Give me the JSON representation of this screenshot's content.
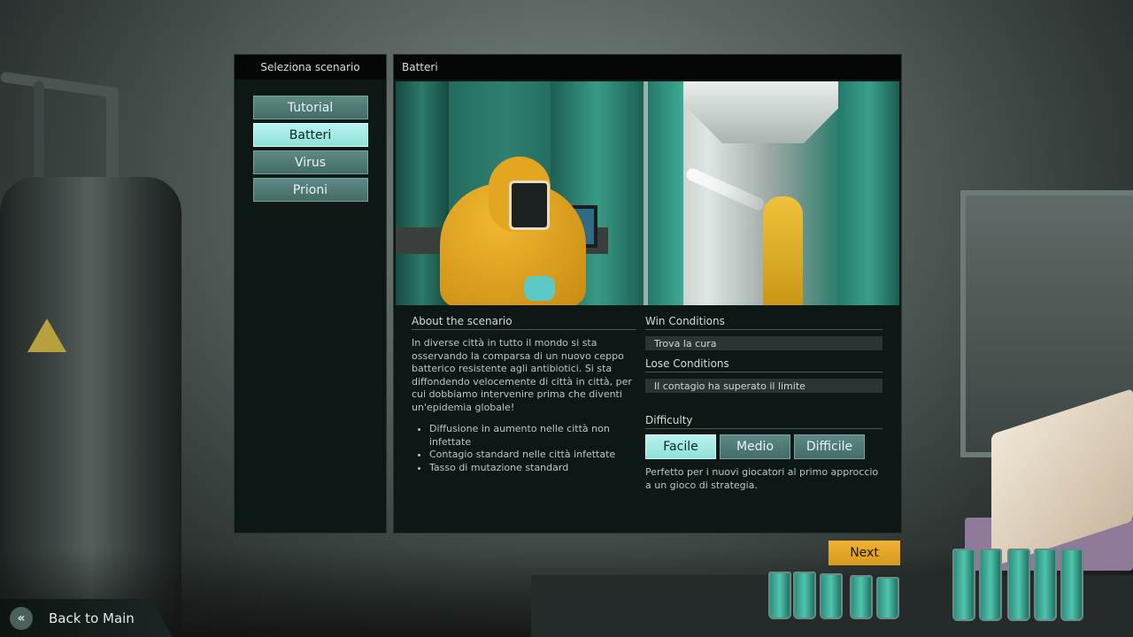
{
  "scenario_panel": {
    "title": "Seleziona scenario",
    "items": [
      {
        "label": "Tutorial",
        "selected": false
      },
      {
        "label": "Batteri",
        "selected": true
      },
      {
        "label": "Virus",
        "selected": false
      },
      {
        "label": "Prioni",
        "selected": false
      }
    ]
  },
  "detail_panel": {
    "title": "Batteri",
    "about": {
      "heading": "About the scenario",
      "text": "In diverse città in tutto il mondo si sta osservando la comparsa di un nuovo ceppo batterico resistente agli antibiotici. Si sta diffondendo velocemente di città in città, per cui dobbiamo intervenire prima che diventi un'epidemia globale!",
      "bullets": [
        "Diffusione in aumento nelle città non infettate",
        "Contagio standard nelle città infettate",
        "Tasso di mutazione standard"
      ]
    },
    "win": {
      "heading": "Win Conditions",
      "value": "Trova la cura"
    },
    "lose": {
      "heading": "Lose Conditions",
      "value": "Il contagio ha superato il limite"
    },
    "difficulty": {
      "heading": "Difficulty",
      "options": [
        {
          "label": "Facile",
          "selected": true
        },
        {
          "label": "Medio",
          "selected": false
        },
        {
          "label": "Difficile",
          "selected": false
        }
      ],
      "description": "Perfetto per i nuovi giocatori al primo approccio a un gioco di strategia."
    }
  },
  "buttons": {
    "next": "Next",
    "back": "Back to Main"
  },
  "colors": {
    "accent_selected": "#a8ece7",
    "button": "#527c77",
    "next_button": "#e6a628",
    "panel": "#0d1816"
  }
}
